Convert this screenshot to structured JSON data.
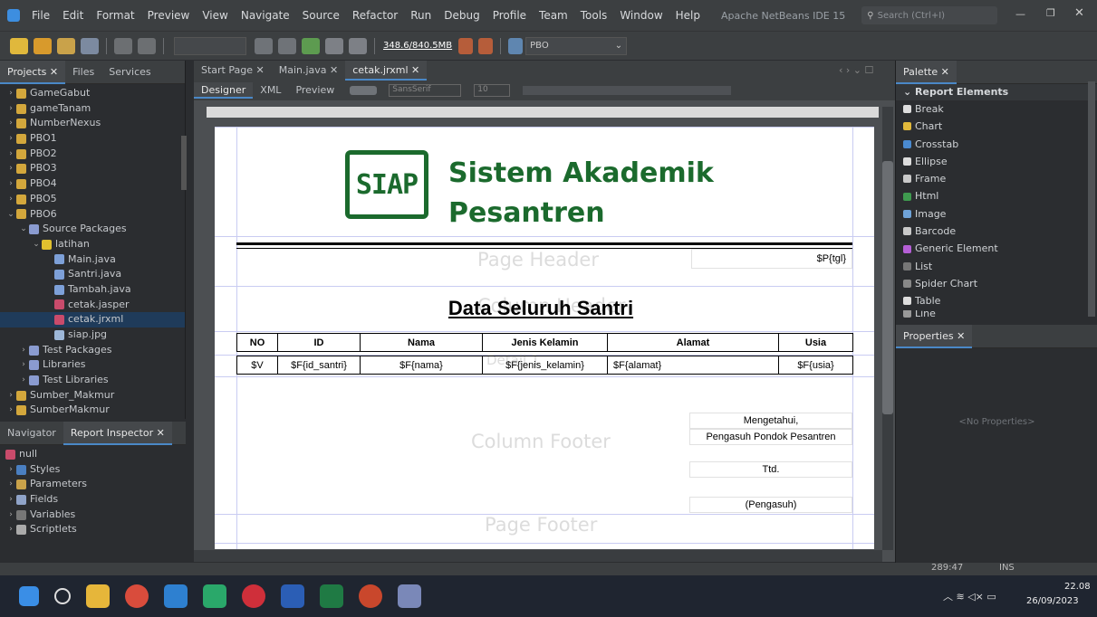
{
  "menu": {
    "items": [
      "File",
      "Edit",
      "Format",
      "Preview",
      "View",
      "Navigate",
      "Source",
      "Refactor",
      "Run",
      "Debug",
      "Profile",
      "Team",
      "Tools",
      "Window",
      "Help"
    ],
    "app_title": "Apache NetBeans IDE 15",
    "search_placeholder": "Search (Ctrl+I)"
  },
  "toolbar": {
    "memory": "348.6/840.5MB",
    "project": "PBO"
  },
  "projects": {
    "tabs": [
      "Projects",
      "Files",
      "Services"
    ],
    "items": [
      {
        "label": "GameGabut",
        "indent": 0,
        "chev": "›"
      },
      {
        "label": "gameTanam",
        "indent": 0,
        "chev": "›"
      },
      {
        "label": "NumberNexus",
        "indent": 0,
        "chev": "›"
      },
      {
        "label": "PBO1",
        "indent": 0,
        "chev": "›"
      },
      {
        "label": "PBO2",
        "indent": 0,
        "chev": "›"
      },
      {
        "label": "PBO3",
        "indent": 0,
        "chev": "›"
      },
      {
        "label": "PBO4",
        "indent": 0,
        "chev": "›"
      },
      {
        "label": "PBO5",
        "indent": 0,
        "chev": "›"
      },
      {
        "label": "PBO6",
        "indent": 0,
        "chev": "⌄"
      },
      {
        "label": "Source Packages",
        "indent": 1,
        "chev": "⌄"
      },
      {
        "label": "latihan",
        "indent": 2,
        "chev": "⌄"
      },
      {
        "label": "Main.java",
        "indent": 3,
        "chev": ""
      },
      {
        "label": "Santri.java",
        "indent": 3,
        "chev": ""
      },
      {
        "label": "Tambah.java",
        "indent": 3,
        "chev": ""
      },
      {
        "label": "cetak.jasper",
        "indent": 3,
        "chev": ""
      },
      {
        "label": "cetak.jrxml",
        "indent": 3,
        "chev": "",
        "selected": true
      },
      {
        "label": "siap.jpg",
        "indent": 3,
        "chev": ""
      },
      {
        "label": "Test Packages",
        "indent": 1,
        "chev": "›"
      },
      {
        "label": "Libraries",
        "indent": 1,
        "chev": "›"
      },
      {
        "label": "Test Libraries",
        "indent": 1,
        "chev": "›"
      },
      {
        "label": "Sumber_Makmur",
        "indent": 0,
        "chev": "›"
      },
      {
        "label": "SumberMakmur",
        "indent": 0,
        "chev": "›"
      }
    ]
  },
  "navigator": {
    "tabs": [
      "Navigator",
      "Report Inspector"
    ],
    "items": [
      "null",
      "Styles",
      "Parameters",
      "Fields",
      "Variables",
      "Scriptlets"
    ]
  },
  "editor": {
    "tabs": [
      "Start Page",
      "Main.java",
      "cetak.jrxml"
    ],
    "modes": [
      "Designer",
      "XML",
      "Preview"
    ],
    "font": "SansSerif",
    "size": "10"
  },
  "report": {
    "logo": "SIAP",
    "title_line1": "Sistem Akademik",
    "title_line2": "Pesantren",
    "tgl": "$P{tgl}",
    "heading": "Data Seluruh Santri",
    "bands": {
      "page_header": "Page Header",
      "column_footer": "Column Footer",
      "page_footer": "Page Footer",
      "column_header": "Column Header",
      "detail": "Detail 1"
    },
    "headers": [
      "NO",
      "ID",
      "Nama",
      "Jenis Kelamin",
      "Alamat",
      "Usia"
    ],
    "row": [
      "$V",
      "$F{id_santri}",
      "$F{nama}",
      "$F{jenis_kelamin}",
      "$F{alamat}",
      "$F{usia}"
    ],
    "sign": {
      "l1": "Mengetahui,",
      "l2": "Pengasuh Pondok Pesantren",
      "l3": "Ttd.",
      "l4": "(Pengasuh)"
    }
  },
  "palette": {
    "title": "Palette",
    "section": "Report Elements",
    "items": [
      "Break",
      "Chart",
      "Crosstab",
      "Ellipse",
      "Frame",
      "Html",
      "Image",
      "Barcode",
      "Generic Element",
      "List",
      "Spider Chart",
      "Table",
      "Line"
    ]
  },
  "properties": {
    "title": "Properties",
    "empty": "<No Properties>"
  },
  "status": {
    "pos": "289:47",
    "mode": "INS"
  },
  "clock": {
    "time": "22.08",
    "date": "26/09/2023"
  }
}
